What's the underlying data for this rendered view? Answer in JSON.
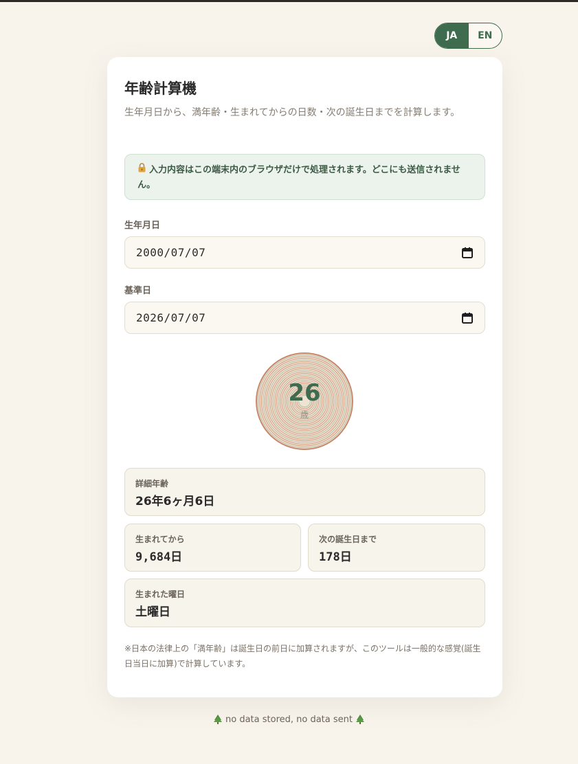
{
  "lang": {
    "ja": "JA",
    "en": "EN",
    "active": "ja"
  },
  "app": {
    "title": "年齢計算機",
    "subtitle": "生年月日から、満年齢・生まれてからの日数・次の誕生日までを計算します。",
    "notice": "入力内容はこの端末内のブラウザだけで処理されます。どこにも送信されません。",
    "notice_icon": "lock-icon"
  },
  "form": {
    "birth_label": "生年月日",
    "birth_value": "2000/07/07",
    "ref_label": "基準日",
    "ref_value": "2026/07/07"
  },
  "result": {
    "age": "26",
    "age_unit": "歳",
    "detail_label": "詳細年齢",
    "detail_value": "26年6ヶ月6日",
    "days_label": "生まれてから",
    "days_value": "9,684日",
    "next_label": "次の誕生日まで",
    "next_value": "178日",
    "weekday_label": "生まれた曜日",
    "weekday_value": "土曜日"
  },
  "footnote": "※日本の法律上の「満年齢」は誕生日の前日に加算されますが、このツールは一般的な感覚(誕生日当日に加算)で計算しています。",
  "footer": {
    "text": "no data stored, no data sent",
    "icon": "tree-icon"
  },
  "colors": {
    "accent": "#3f6b4e",
    "ring": "#c8876a",
    "background": "#f8f4ec"
  }
}
